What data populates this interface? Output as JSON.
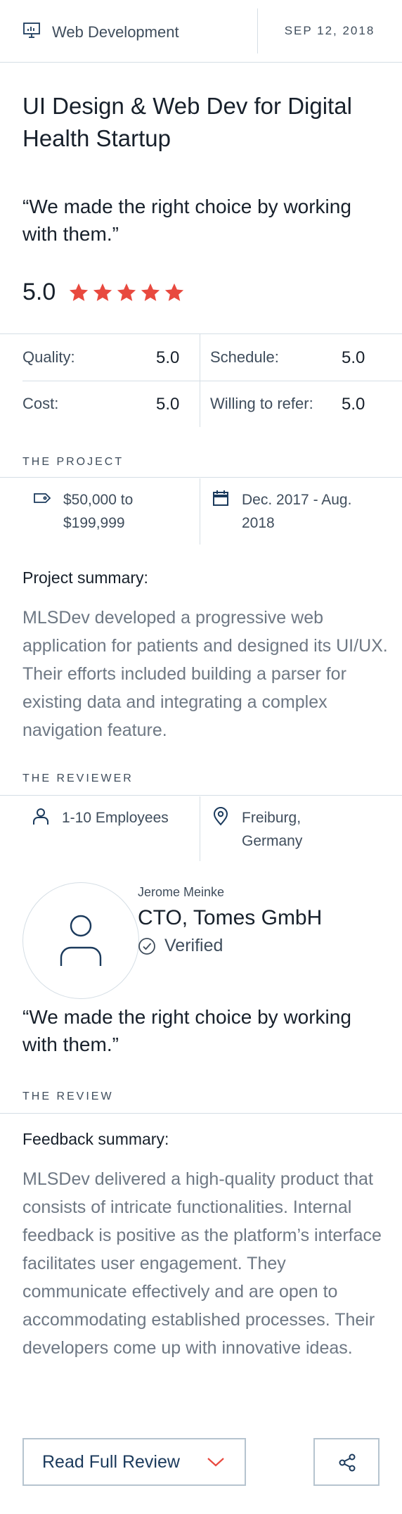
{
  "header": {
    "category": "Web Development",
    "category_icon": "monitor-chart-icon",
    "date": "SEP 12, 2018"
  },
  "title": "UI Design & Web Dev for Digital Health Startup",
  "quote": "“We made the right choice by working with them.”",
  "rating": {
    "value": "5.0",
    "stars": 5,
    "star_color": "#e8493f"
  },
  "scores": {
    "quality_label": "Quality:",
    "quality_value": "5.0",
    "schedule_label": "Schedule:",
    "schedule_value": "5.0",
    "cost_label": "Cost:",
    "cost_value": "5.0",
    "refer_label": "Willing to refer:",
    "refer_value": "5.0"
  },
  "project": {
    "heading": "THE PROJECT",
    "budget_line1": "$50,000 to",
    "budget_line2": "$199,999",
    "budget_icon": "price-tag-icon",
    "dates_line1": "Dec. 2017 - Aug.",
    "dates_line2": "2018",
    "dates_icon": "calendar-icon",
    "summary_label": "Project summary:",
    "summary": "MLSDev developed a progressive web application for patients and designed its UI/UX. Their efforts included building a parser for existing data and integrating a complex navigation feature."
  },
  "reviewer": {
    "heading": "THE REVIEWER",
    "employees": "1-10 Employees",
    "employees_icon": "person-icon",
    "location_line1": "Freiburg,",
    "location_line2": "Germany",
    "location_icon": "location-pin-icon",
    "name": "Jerome Meinke",
    "role": "CTO, Tomes GmbH",
    "verified": "Verified",
    "quote": "“We made the right choice by working with them.”"
  },
  "review": {
    "heading": "THE REVIEW",
    "feedback_label": "Feedback summary:",
    "feedback": "MLSDev delivered a high-quality product that consists of intricate functionalities. Internal feedback is positive as the platform’s interface facilitates user engagement. They communicate effectively and are open to accommodating established processes. Their developers come up with innovative ideas."
  },
  "actions": {
    "read_full": "Read Full Review",
    "accent": "#e8493f"
  }
}
